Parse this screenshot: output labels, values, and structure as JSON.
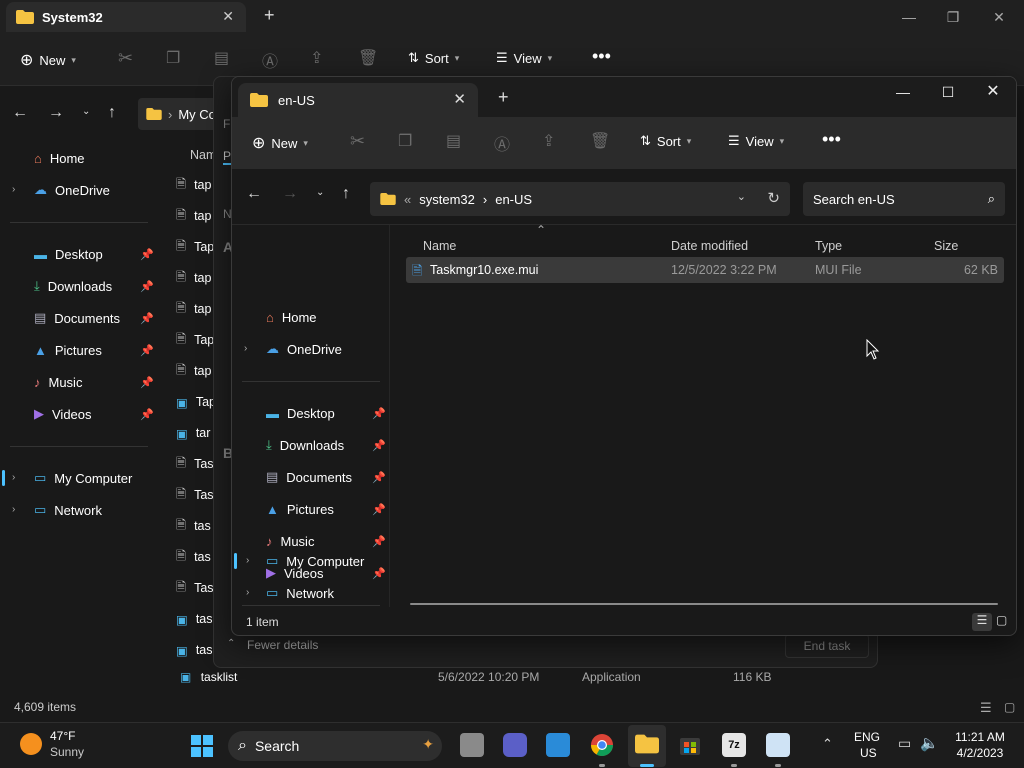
{
  "background_window": {
    "tab_title": "System32",
    "toolbar": {
      "new_label": "New",
      "sort_label": "Sort",
      "view_label": "View"
    },
    "address_partial": "My Co",
    "column_name_partial": "Nam",
    "sidebar": {
      "home": "Home",
      "onedrive": "OneDrive",
      "quick": [
        "Desktop",
        "Downloads",
        "Documents",
        "Pictures",
        "Music",
        "Videos"
      ],
      "my_computer": "My Computer",
      "network": "Network"
    },
    "files_partial": [
      "tap",
      "tap",
      "Tap",
      "tap",
      "tap",
      "Tap",
      "tap",
      "Tap",
      "tar",
      "Tas",
      "Tas",
      "tas",
      "tas",
      "Tas",
      "tas",
      "tas"
    ],
    "last_row": {
      "name": "tasklist",
      "date": "5/6/2022 10:20 PM",
      "type": "Application",
      "size": "116 KB"
    },
    "status": "4,609 items"
  },
  "task_manager": {
    "fewer_details": "Fewer details",
    "end_task": "End task",
    "side_letters": [
      "F",
      "Pr",
      "Na",
      "A",
      "B"
    ]
  },
  "foreground_window": {
    "tab_title": "en-US",
    "toolbar": {
      "new_label": "New",
      "sort_label": "Sort",
      "view_label": "View"
    },
    "breadcrumb": [
      "system32",
      "en-US"
    ],
    "search_placeholder": "Search en-US",
    "sidebar": {
      "home": "Home",
      "onedrive": "OneDrive",
      "quick": [
        "Desktop",
        "Downloads",
        "Documents",
        "Pictures",
        "Music",
        "Videos"
      ],
      "my_computer": "My Computer",
      "network": "Network"
    },
    "columns": {
      "name": "Name",
      "date": "Date modified",
      "type": "Type",
      "size": "Size"
    },
    "files": [
      {
        "name": "Taskmgr10.exe.mui",
        "date": "12/5/2022 3:22 PM",
        "type": "MUI File",
        "size": "62 KB"
      }
    ],
    "status": "1 item"
  },
  "taskbar": {
    "weather_temp": "47°F",
    "weather_desc": "Sunny",
    "search_label": "Search",
    "lang_line1": "ENG",
    "lang_line2": "US",
    "time": "11:21 AM",
    "date": "4/2/2023"
  },
  "colors": {
    "accent": "#4cc2ff",
    "folder": "#f5c342",
    "selection": "#3a3a3a"
  }
}
